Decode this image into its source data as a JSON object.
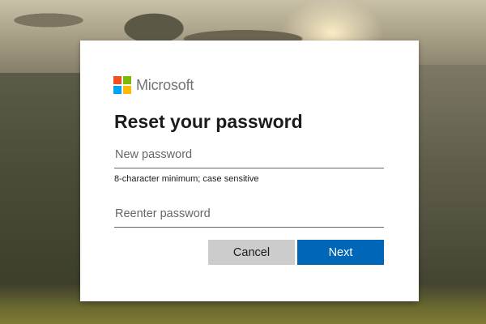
{
  "brand": {
    "name": "Microsoft",
    "logo_colors": [
      "#f25022",
      "#7fba00",
      "#00a4ef",
      "#ffb900"
    ]
  },
  "dialog": {
    "title": "Reset your password",
    "new_password": {
      "placeholder": "New password",
      "value": ""
    },
    "hint": "8-character minimum; case sensitive",
    "reenter_password": {
      "placeholder": "Reenter password",
      "value": ""
    },
    "cancel_label": "Cancel",
    "next_label": "Next"
  },
  "colors": {
    "accent": "#0067b8",
    "secondary_button": "#cccccc"
  }
}
